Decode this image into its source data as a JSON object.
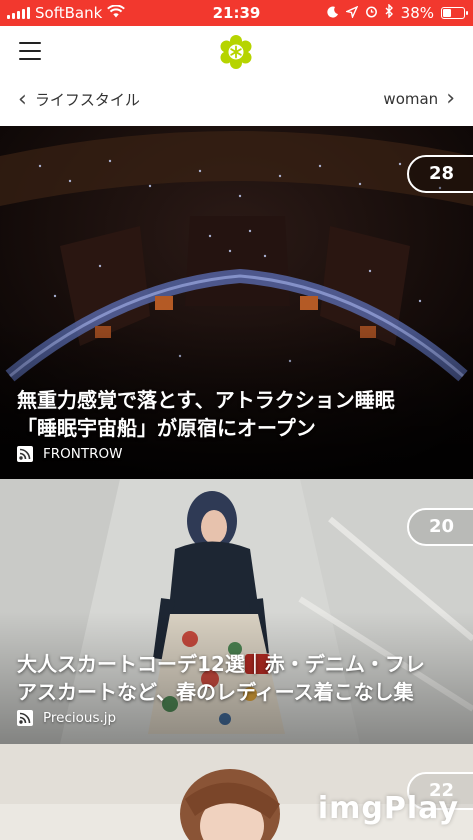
{
  "status_bar": {
    "carrier": "SoftBank",
    "time": "21:39",
    "battery": "38%",
    "battery_level": 0.38,
    "icons": [
      "signal-icon",
      "wifi-icon",
      "moon-icon",
      "location-icon",
      "alarm-icon",
      "bluetooth-icon",
      "battery-icon"
    ]
  },
  "header": {
    "menu_icon": "hamburger-icon",
    "logo_icon": "flower-logo-icon",
    "logo_color": "#b6d400"
  },
  "category_nav": {
    "prev_label": "ライフスタイル",
    "next_label": "woman"
  },
  "articles": [
    {
      "title_line1": "無重力感覚で落とす、アトラクション睡眠",
      "title_line2": "「睡眠宇宙船」が原宿にオープン",
      "source": "FRONTROW",
      "count": "28"
    },
    {
      "title_line1": "大人スカートコーデ12選｜赤・デニム・フレ",
      "title_line2": "アスカートなど、春のレディース着こなし集",
      "source": "Precious.jp",
      "count": "20"
    },
    {
      "count": "22"
    }
  ],
  "watermark": "imgPlay",
  "colors": {
    "status_bar": "#f2382e",
    "accent": "#b6d400"
  }
}
